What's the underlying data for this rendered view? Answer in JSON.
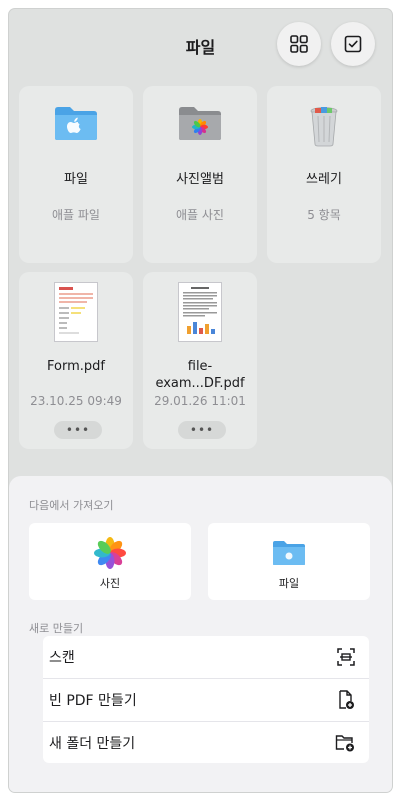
{
  "header": {
    "title": "파일",
    "grid_icon": "grid-icon",
    "select_icon": "checkbox-icon"
  },
  "files": [
    {
      "name": "파일",
      "sub": "애플 파일",
      "icon": "blue-folder-icon"
    },
    {
      "name": "사진앨범",
      "sub": "애플 사진",
      "icon": "gray-folder-photos-icon"
    },
    {
      "name": "쓰레기",
      "sub": "5 항목",
      "icon": "trash-can-icon"
    },
    {
      "name": "Form.pdf",
      "sub": "23.10.25 09:49",
      "more": "•••",
      "icon": "pdf-document-icon"
    },
    {
      "name": "file-exam...DF.pdf",
      "name_line1": "file-",
      "name_line2": "exam...DF.pdf",
      "sub": "29.01.26 11:01",
      "more": "•••",
      "icon": "pdf-document-icon"
    }
  ],
  "sheet": {
    "import_label": "다음에서 가져오기",
    "sources": [
      {
        "label": "사진",
        "icon": "photos-icon"
      },
      {
        "label": "파일",
        "icon": "files-folder-icon"
      }
    ],
    "create_label": "새로 만들기",
    "actions": [
      {
        "label": "스캔",
        "icon": "scan-icon"
      },
      {
        "label": "빈 PDF 만들기",
        "icon": "new-document-icon"
      },
      {
        "label": "새 폴더 만들기",
        "icon": "new-folder-icon"
      }
    ]
  },
  "colors": {
    "background": "#dfe1e0",
    "card": "#e8eae9",
    "sheet": "#f2f2f4",
    "folder_blue": "#5aaeea",
    "secondary_text": "#8e8e93"
  }
}
